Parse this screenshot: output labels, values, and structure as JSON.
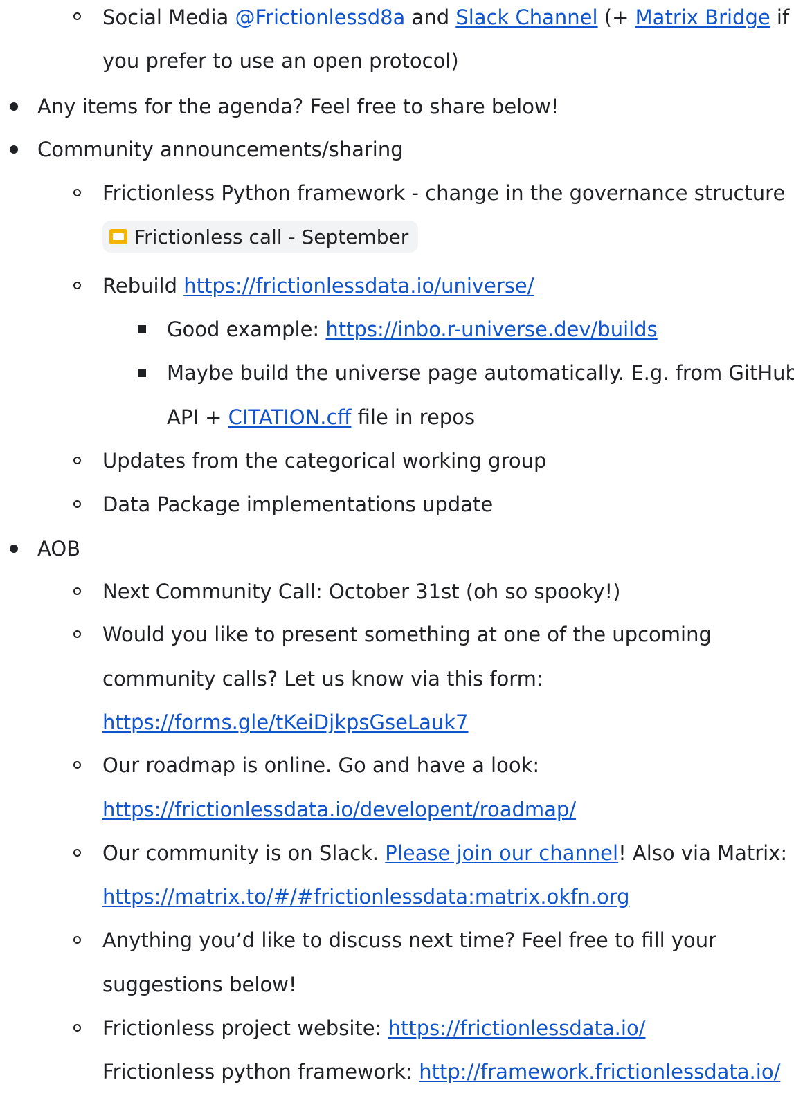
{
  "l1": {
    "pre": "Social Media ",
    "social": "@Frictionlessd8a",
    "mid": " and ",
    "slack": "Slack Channel",
    "paren": " (+ ",
    "matrix": "Matrix Bridge",
    "post": " if"
  },
  "l2": "you prefer to use an open protocol)",
  "l3": "Any items for the agenda? Feel free to share below!",
  "l4": "Community announcements/sharing",
  "l5": "Frictionless Python framework - change in the governance structure",
  "chip": {
    "label": "Frictionless call - September",
    "icon": "slides-icon",
    "icon_color": "#f4b400"
  },
  "l6": {
    "pre": "Rebuild ",
    "url": "https://frictionlessdata.io/universe/"
  },
  "l7": {
    "pre": "Good example: ",
    "url": "https://inbo.r-universe.dev/builds"
  },
  "l8": "Maybe build the universe page automatically. E.g. from GitHub",
  "l9": {
    "pre": "API + ",
    "link": "CITATION.cff",
    "post": " file in repos"
  },
  "l10": "Updates from the categorical working group",
  "l11": "Data Package implementations update",
  "l12": "AOB",
  "l13": "Next Community Call: October 31st (oh so spooky!)",
  "l14": "Would you like to present something at one of the upcoming",
  "l15": "community calls? Let us know via this form:",
  "l16": "https://forms.gle/tKeiDjkpsGseLauk7",
  "l17": "Our roadmap is online. Go and have a look:",
  "l18": "https://frictionlessdata.io/developent/roadmap/",
  "l19": {
    "pre": "Our community is on Slack. ",
    "link": "Please join our channel",
    "post": "! Also via Matrix:"
  },
  "l20": "https://matrix.to/#/#frictionlessdata:matrix.okfn.org",
  "l21": "Anything you’d like to discuss next time? Feel free to fill your",
  "l22": "suggestions below!",
  "l23": {
    "pre": "Frictionless project website: ",
    "url": "https://frictionlessdata.io/"
  },
  "l24": {
    "pre": "Frictionless python framework: ",
    "url": "http://framework.frictionlessdata.io/"
  },
  "colors": {
    "link": "#1155cc",
    "text": "#202124",
    "chip_bg": "#f1f3f4"
  }
}
